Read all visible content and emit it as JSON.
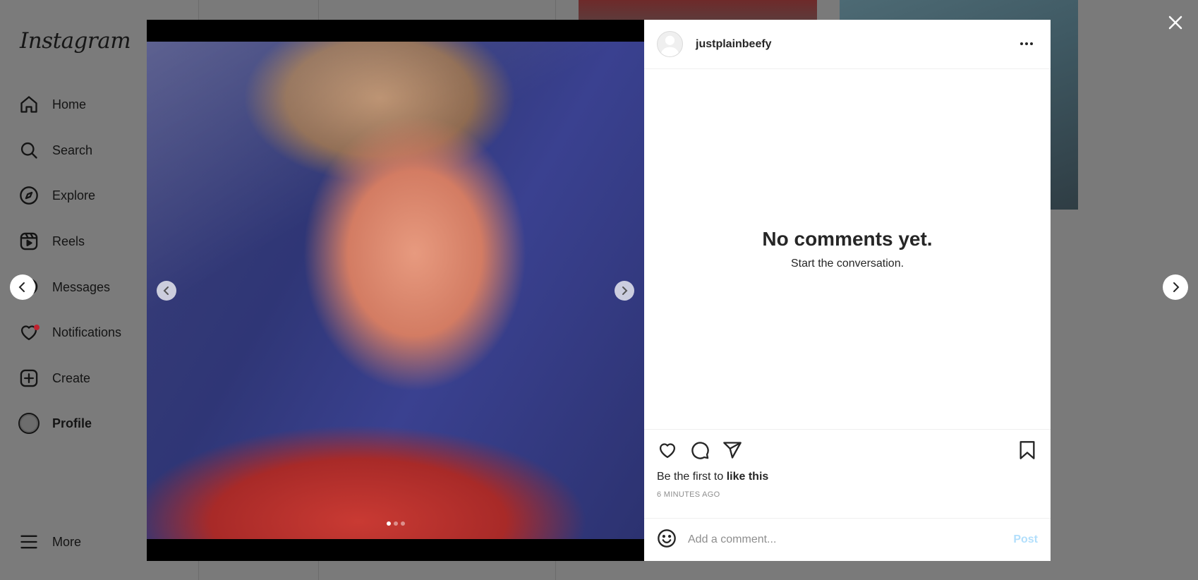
{
  "app": {
    "logo": "Instagram"
  },
  "sidebar": {
    "items": [
      {
        "label": "Home",
        "icon": "home-icon"
      },
      {
        "label": "Search",
        "icon": "search-icon"
      },
      {
        "label": "Explore",
        "icon": "compass-icon"
      },
      {
        "label": "Reels",
        "icon": "reels-icon"
      },
      {
        "label": "Messages",
        "icon": "messenger-icon"
      },
      {
        "label": "Notifications",
        "icon": "heart-icon"
      },
      {
        "label": "Create",
        "icon": "plus-square-icon"
      },
      {
        "label": "Profile",
        "icon": "avatar"
      }
    ],
    "more_label": "More"
  },
  "post": {
    "username": "justplainbeefy",
    "image_count": 3,
    "active_index": 0,
    "no_comments_title": "No comments yet.",
    "no_comments_sub": "Start the conversation.",
    "likes_prefix": "Be the first to ",
    "likes_link": "like this",
    "timestamp": "6 MINUTES AGO",
    "comment_placeholder": "Add a comment...",
    "post_label": "Post"
  },
  "colors": {
    "overlay": "#7a7a7a",
    "post_button_disabled": "#b2dffc",
    "notification_dot": "#c0222f"
  }
}
